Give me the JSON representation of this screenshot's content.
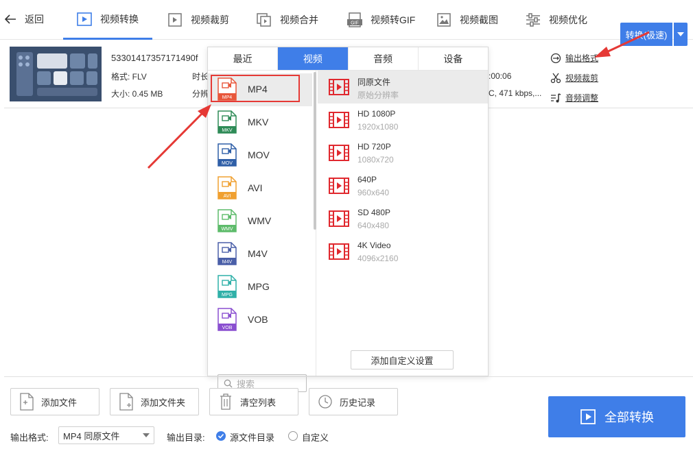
{
  "colors": {
    "accent": "#3f7ee8",
    "highlight_red": "#e53935",
    "film_red": "#e0282e"
  },
  "nav": {
    "back_label": "返回",
    "tabs": [
      {
        "label": "视频转换",
        "icon": "video-convert-icon",
        "active": true
      },
      {
        "label": "视频裁剪",
        "icon": "video-crop-icon"
      },
      {
        "label": "视频合并",
        "icon": "video-merge-icon"
      },
      {
        "label": "视频转GIF",
        "icon": "gif-icon"
      },
      {
        "label": "视频截图",
        "icon": "screenshot-icon"
      },
      {
        "label": "视频优化",
        "icon": "optimize-icon"
      }
    ]
  },
  "file": {
    "name": "53301417357171490f",
    "format": "格式: FLV",
    "size": "大小: 0.45 MB",
    "duration_label": "时长",
    "resolution_label": "分辨",
    "duration_right": ":00:06",
    "codec_right": "C, 471 kbps,..."
  },
  "side_links": {
    "output_format": "输出格式",
    "video_crop": "视频裁剪",
    "audio_adjust": "音频调整"
  },
  "convert_button": "转换(极速)",
  "dropdown": {
    "tabs": [
      "最近",
      "视频",
      "音频",
      "设备"
    ],
    "active_tab": "视频",
    "formats": [
      {
        "label": "MP4",
        "tag": "MP4",
        "color": "#e8563a"
      },
      {
        "label": "MKV",
        "tag": "MKV",
        "color": "#2e8b57"
      },
      {
        "label": "MOV",
        "tag": "MOV",
        "color": "#2f5fa7"
      },
      {
        "label": "AVI",
        "tag": "AVI",
        "color": "#f0a030"
      },
      {
        "label": "WMV",
        "tag": "WMV",
        "color": "#5dbb6a"
      },
      {
        "label": "M4V",
        "tag": "M4V",
        "color": "#4a5fa8"
      },
      {
        "label": "MPG",
        "tag": "MPG",
        "color": "#2fb0a8"
      },
      {
        "label": "VOB",
        "tag": "VOB",
        "color": "#8a4fd0"
      }
    ],
    "search_placeholder": "搜索",
    "resolutions": [
      {
        "title": "同原文件",
        "sub": "原始分辨率"
      },
      {
        "title": "HD 1080P",
        "sub": "1920x1080"
      },
      {
        "title": "HD 720P",
        "sub": "1080x720"
      },
      {
        "title": "640P",
        "sub": "960x640"
      },
      {
        "title": "SD 480P",
        "sub": "640x480"
      },
      {
        "title": "4K Video",
        "sub": "4096x2160"
      }
    ],
    "custom_button": "添加自定义设置"
  },
  "bottom": {
    "add_file": "添加文件",
    "add_folder": "添加文件夹",
    "clear_list": "清空列表",
    "history": "历史记录",
    "convert_all": "全部转换",
    "output_format_label": "输出格式:",
    "output_format_value": "MP4 同原文件",
    "output_dir_label": "输出目录:",
    "dir_source": "源文件目录",
    "dir_custom": "自定义"
  }
}
